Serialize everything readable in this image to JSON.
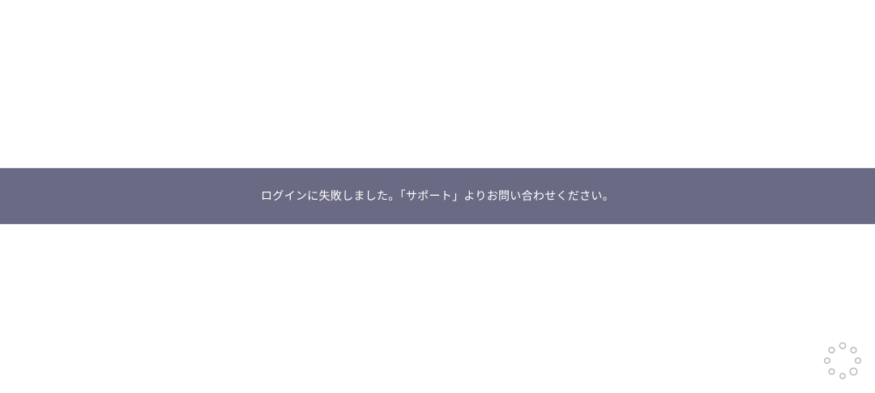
{
  "banner": {
    "message": "ログインに失敗しました。「サポート」よりお問い合わせください。",
    "background_color": "#6a6a84",
    "text_color": "#ffffff"
  },
  "spinner": {
    "icon": "loading-spinner-icon",
    "color": "#b5b5c0"
  }
}
